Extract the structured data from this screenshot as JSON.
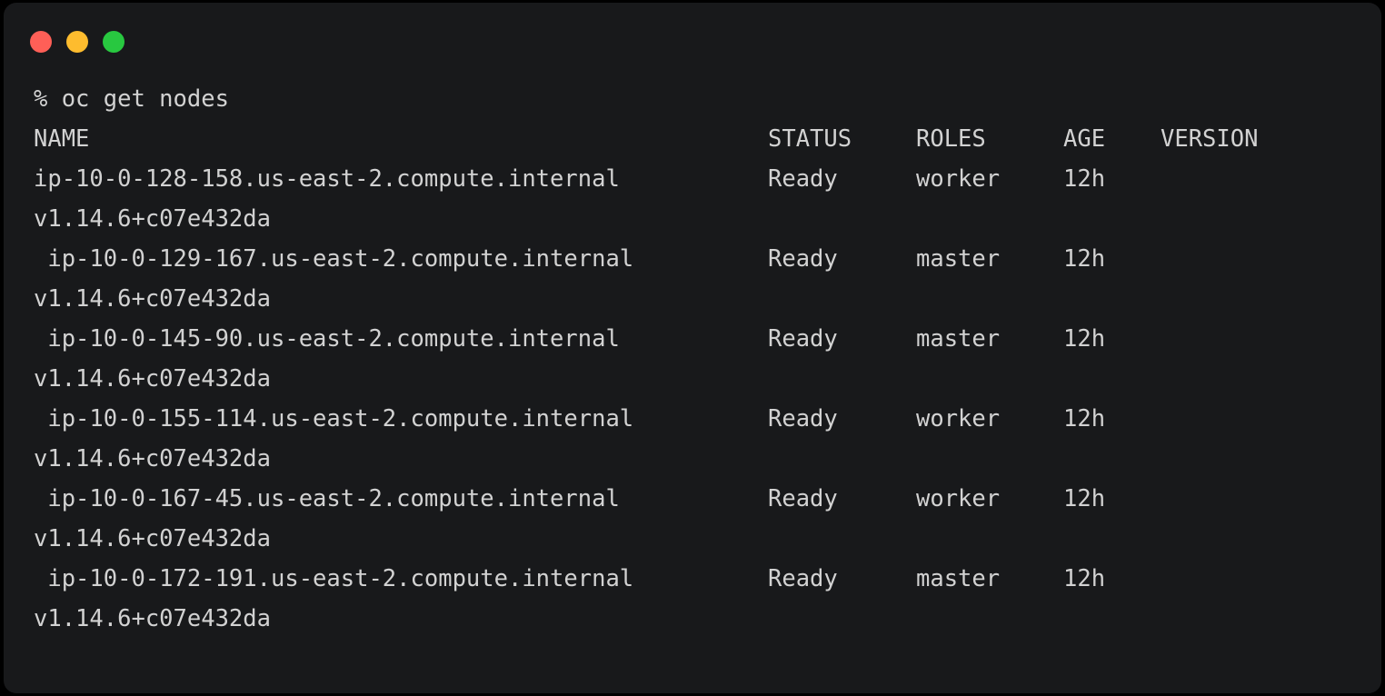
{
  "window": {
    "title": "Terminal",
    "traffic_lights": [
      {
        "name": "close",
        "color": "#ff5f57"
      },
      {
        "name": "minimize",
        "color": "#febc2e"
      },
      {
        "name": "maximize",
        "color": "#28c840"
      }
    ],
    "background_color": "#18191b",
    "text_color": "#d2d2d2"
  },
  "terminal": {
    "prompt_symbol": "%",
    "command": "oc get nodes",
    "prompt_line": "% oc get nodes",
    "headers": {
      "name": "NAME",
      "status": "STATUS",
      "roles": "ROLES",
      "age": "AGE",
      "version": "VERSION"
    },
    "rows": [
      {
        "name": "ip-10-0-128-158.us-east-2.compute.internal",
        "status": "Ready",
        "roles": "worker",
        "age": "12h",
        "version": "v1.14.6+c07e432da"
      },
      {
        "name": "ip-10-0-129-167.us-east-2.compute.internal",
        "status": "Ready",
        "roles": "master",
        "age": "12h",
        "version": "v1.14.6+c07e432da"
      },
      {
        "name": "ip-10-0-145-90.us-east-2.compute.internal",
        "status": "Ready",
        "roles": "master",
        "age": "12h",
        "version": "v1.14.6+c07e432da"
      },
      {
        "name": "ip-10-0-155-114.us-east-2.compute.internal",
        "status": "Ready",
        "roles": "worker",
        "age": "12h",
        "version": "v1.14.6+c07e432da"
      },
      {
        "name": "ip-10-0-167-45.us-east-2.compute.internal",
        "status": "Ready",
        "roles": "worker",
        "age": "12h",
        "version": "v1.14.6+c07e432da"
      },
      {
        "name": "ip-10-0-172-191.us-east-2.compute.internal",
        "status": "Ready",
        "roles": "master",
        "age": "12h",
        "version": "v1.14.6+c07e432da"
      }
    ]
  }
}
